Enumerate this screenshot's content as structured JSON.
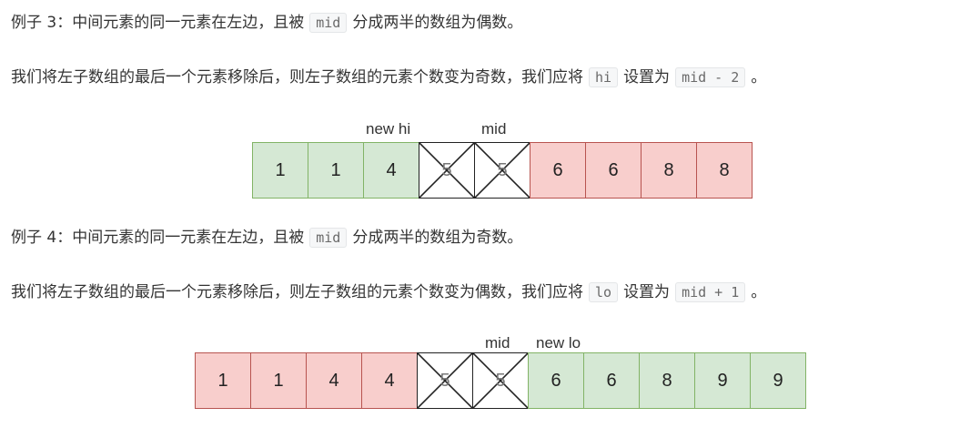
{
  "example3": {
    "line1": {
      "pre": "例子 3：中间元素的同一元素在左边，且被",
      "code": "mid",
      "post": "分成两半的数组为偶数。"
    },
    "line2": {
      "pre": "我们将左子数组的最后一个元素移除后，则左子数组的元素个数变为奇数，我们应将",
      "code1": "hi",
      "mid": "设置为",
      "code2": "mid - 2",
      "post": "。"
    },
    "diagram": {
      "cells": [
        {
          "value": "1",
          "color": "green"
        },
        {
          "value": "1",
          "color": "green"
        },
        {
          "value": "4",
          "color": "green"
        },
        {
          "value": "5",
          "color": "cross"
        },
        {
          "value": "5",
          "color": "cross"
        },
        {
          "value": "6",
          "color": "red"
        },
        {
          "value": "6",
          "color": "red"
        },
        {
          "value": "8",
          "color": "red"
        },
        {
          "value": "8",
          "color": "red"
        }
      ],
      "label_new": "new hi",
      "label_mid": "mid"
    }
  },
  "example4": {
    "line1": {
      "pre": "例子 4：中间元素的同一元素在左边，且被",
      "code": "mid",
      "post": "分成两半的数组为奇数。"
    },
    "line2": {
      "pre": "我们将左子数组的最后一个元素移除后，则左子数组的元素个数变为偶数，我们应将",
      "code1": "lo",
      "mid": "设置为",
      "code2": "mid + 1",
      "post": "。"
    },
    "diagram": {
      "cells": [
        {
          "value": "1",
          "color": "red"
        },
        {
          "value": "1",
          "color": "red"
        },
        {
          "value": "4",
          "color": "red"
        },
        {
          "value": "4",
          "color": "red"
        },
        {
          "value": "5",
          "color": "cross"
        },
        {
          "value": "5",
          "color": "cross"
        },
        {
          "value": "6",
          "color": "green"
        },
        {
          "value": "6",
          "color": "green"
        },
        {
          "value": "8",
          "color": "green"
        },
        {
          "value": "9",
          "color": "green"
        },
        {
          "value": "9",
          "color": "green"
        }
      ],
      "label_mid": "mid",
      "label_new": "new lo"
    }
  },
  "colors": {
    "green_fill": "#d5e8d4",
    "green_border": "#82b366",
    "red_fill": "#f8cecc",
    "red_border": "#b85450"
  }
}
